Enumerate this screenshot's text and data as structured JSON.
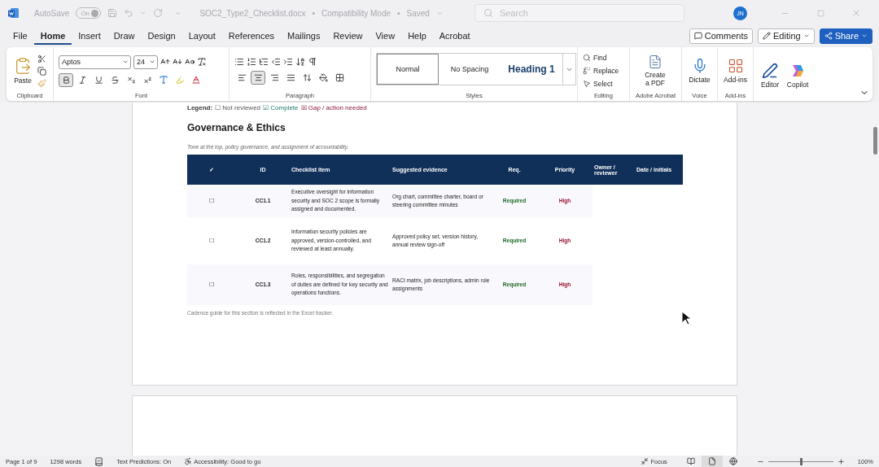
{
  "title_bar": {
    "autosave_label": "AutoSave",
    "autosave": {
      "label": "On",
      "on": true
    },
    "document_title": "SOC2_Type2_Checklist.docx",
    "separators": [
      "•",
      "•"
    ],
    "mode": "Compatibility Mode",
    "save_status": "Saved",
    "search": {
      "placeholder": "Search"
    },
    "avatar": "JN"
  },
  "menu_tabs": [
    {
      "label": "File",
      "selected": false
    },
    {
      "label": "Home",
      "selected": true
    },
    {
      "label": "Insert",
      "selected": false
    },
    {
      "label": "Draw",
      "selected": false
    },
    {
      "label": "Design",
      "selected": false
    },
    {
      "label": "Layout",
      "selected": false
    },
    {
      "label": "References",
      "selected": false
    },
    {
      "label": "Mailings",
      "selected": false
    },
    {
      "label": "Review",
      "selected": false
    },
    {
      "label": "View",
      "selected": false
    },
    {
      "label": "Help",
      "selected": false
    },
    {
      "label": "Acrobat",
      "selected": false
    }
  ],
  "header_buttons": {
    "comments": "Comments",
    "editing": "Editing",
    "share": "Share"
  },
  "ribbon": {
    "clipboard": {
      "paste": "Paste",
      "label": "Clipboard"
    },
    "font": {
      "name": "Aptos",
      "size": "24",
      "bold": true,
      "label": "Font"
    },
    "paragraph": {
      "alignments": [
        {
          "selected": false
        },
        {
          "selected": true
        },
        {
          "selected": false
        },
        {
          "selected": false
        }
      ],
      "label": "Paragraph"
    },
    "styles": {
      "items": [
        {
          "label": "Normal",
          "selected": true
        },
        {
          "label": "No Spacing",
          "selected": false
        },
        {
          "label": "Heading 1",
          "selected": false
        }
      ],
      "label": "Styles"
    },
    "editing": {
      "items": [
        "Find",
        "Replace",
        "Select"
      ],
      "label": "Editing"
    },
    "acrobat": {
      "button": "Create a PDF",
      "label": "Adobe Acrobat"
    },
    "voice": {
      "button": "Dictate",
      "label": "Voice"
    },
    "addins": {
      "button": "Add-ins",
      "label": "Add-ins"
    },
    "tools": [
      "Editor",
      "Copilot"
    ]
  },
  "document": {
    "legend": {
      "label": "Legend:",
      "items": [
        {
          "symbol": "☐",
          "text": "Not reviewed",
          "kind": "pending"
        },
        {
          "symbol": "☑",
          "text": "Complete",
          "kind": "complete"
        },
        {
          "symbol": "☒",
          "text": "Gap / action needed",
          "kind": "gap"
        }
      ]
    },
    "heading": "Governance & Ethics",
    "intro": "Tone at the top, policy governance, and assignment of accountability.",
    "table": {
      "columns": [
        "✓",
        "ID",
        "Checklist item",
        "Suggested evidence",
        "Req.",
        "Priority",
        "Owner / reviewer",
        "Date / initials"
      ],
      "rows": [
        {
          "check": "☐",
          "id": "CC1.1",
          "item": "Executive oversight for information security and SOC 2 scope is formally assigned and documented.",
          "evidence": "Org chart, committee charter, board or steering committee minutes",
          "req": "Required",
          "priority": "High"
        },
        {
          "check": "☐",
          "id": "CC1.2",
          "item": "Information security policies are approved, version-controlled, and reviewed at least annually.",
          "evidence": "Approved policy set, version history, annual review sign-off",
          "req": "Required",
          "priority": "High"
        },
        {
          "check": "☐",
          "id": "CC1.3",
          "item": "Roles, responsibilities, and segregation of duties are defined for key security and operations functions.",
          "evidence": "RACI matrix, job descriptions, admin role assignments",
          "req": "Required",
          "priority": "High"
        }
      ]
    },
    "note": "Cadence guide for this section is reflected in the Excel tracker."
  },
  "status_bar": {
    "page": "Page 1 of 9",
    "words": "1298 words",
    "predictions": "Text Predictions: On",
    "accessibility": "Accessibility: Good to go",
    "focus": "Focus",
    "views": [
      {
        "selected": false
      },
      {
        "selected": true
      },
      {
        "selected": false
      }
    ],
    "zoom": {
      "level": 0.5
    },
    "zoom_label": "100%"
  }
}
